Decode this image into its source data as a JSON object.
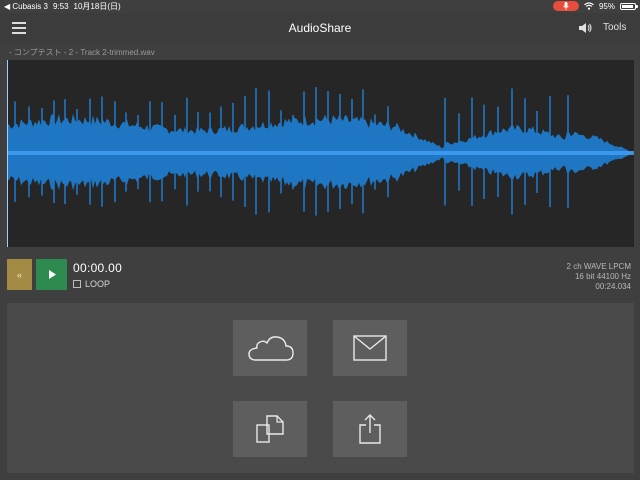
{
  "status_bar": {
    "back_app": "◀ Cubasis 3",
    "time": "9:53",
    "date": "10月18日(日)",
    "battery": "95%",
    "battery_level": 0.95
  },
  "nav": {
    "title": "AudioShare",
    "tools_label": "Tools"
  },
  "file": {
    "name": "- コンプテスト - 2 - Track 2-trimmed.wav"
  },
  "waveform": {
    "background": "#262626",
    "color": "#1f77c4",
    "center_color": "#48a6ff"
  },
  "transport": {
    "rewind_label": "«",
    "time": "00:00.00",
    "loop_label": "LOOP",
    "loop_checked": false
  },
  "file_info": {
    "format": "2 ch WAVE LPCM",
    "bits_rate": "16 bit 44100 Hz",
    "duration": "00:24.034"
  },
  "actions": {
    "icons": [
      "cloud-icon",
      "mail-icon",
      "copy-icon",
      "share-icon"
    ]
  },
  "colors": {
    "rewind": "#a38b45",
    "play": "#2e8b4f",
    "mic_indicator": "#e74c3c"
  }
}
